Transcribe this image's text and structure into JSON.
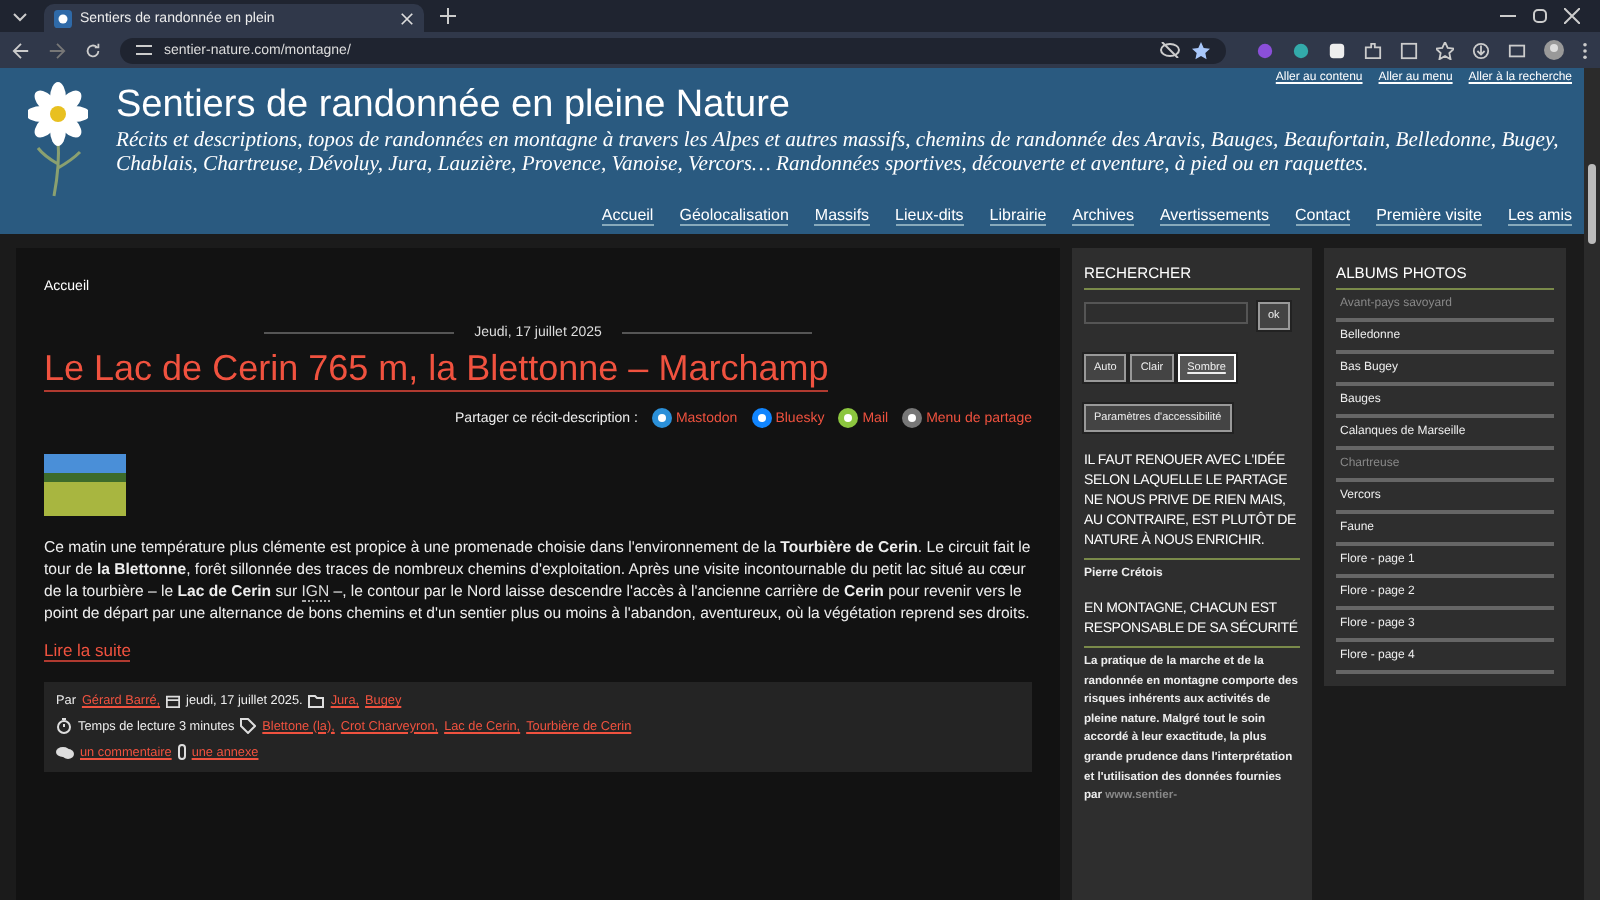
{
  "browser": {
    "tab_title": "Sentiers de randonnée en plein",
    "url": "sentier-nature.com/montagne/"
  },
  "skip_links": [
    "Aller au contenu",
    "Aller au menu",
    "Aller à la recherche"
  ],
  "header": {
    "title": "Sentiers de randonnée en pleine Nature",
    "tagline": "Récits et descriptions, topos de randonnées en montagne à travers les Alpes et autres massifs, chemins de randonnée des Aravis, Bauges, Beaufortain, Belledonne, Bugey, Chablais, Chartreuse, Dévoluy, Jura, Lauzière, Provence, Vanoise, Vercors… Randonnées sportives, découverte et aventure, à pied ou en raquettes."
  },
  "nav": [
    "Accueil",
    "Géolocalisation",
    "Massifs",
    "Lieux-dits",
    "Librairie",
    "Archives",
    "Avertissements",
    "Contact",
    "Première visite",
    "Les amis"
  ],
  "breadcrumb": "Accueil",
  "post": {
    "date": "Jeudi, 17 juillet 2025",
    "title": "Le Lac de Cerin 765 m, la Blettonne – Marchamp",
    "share_label": "Partager ce récit-description :",
    "share": [
      {
        "label": "Mastodon",
        "color": "#2b90d9"
      },
      {
        "label": "Bluesky",
        "color": "#1185fe"
      },
      {
        "label": "Mail",
        "color": "#8cc63f"
      },
      {
        "label": "Menu de partage",
        "color": "#777777"
      }
    ],
    "body_before": "Ce matin une température plus clémente est propice à une promenade choisie dans l'environnement de la **Tourbière de Cerin**. Le circuit fait le tour de **la Blettonne**, forêt sillonnée des traces de nombreux chemins d'exploitation. Après une visite incontournable du petit lac situé au cœur de la tourbière – le **Lac de Cerin** sur",
    "body_link": "IGN",
    "body_after": "–, le contour par le Nord laisse descendre l'accès à l'ancienne carrière de **Cerin** pour revenir vers le point de départ par une alternance de bons chemins et d'un sentier plus ou moins à l'abandon, aventureux, où la végétation reprend ses droits.",
    "read_more": "Lire la suite",
    "meta": {
      "by": "Par",
      "author": "Gérard Barré,",
      "date": "jeudi, 17 juillet 2025.",
      "categories": [
        "Jura,",
        "Bugey"
      ],
      "reading_time": "Temps de lecture 3 minutes",
      "tags": [
        "Blettone (la),",
        "Crot Charveyron,",
        "Lac de Cerin,",
        "Tourbière de Cerin"
      ],
      "comments": "un commentaire",
      "attachments": "une annexe"
    }
  },
  "search": {
    "title": "RECHERCHER",
    "button": "ok"
  },
  "themes": [
    {
      "label": "Auto",
      "selected": false
    },
    {
      "label": "Clair",
      "selected": false
    },
    {
      "label": "Sombre",
      "selected": true
    }
  ],
  "accessibility_button": "Paramètres d'accessibilité",
  "quote": {
    "text": "IL FAUT RENOUER AVEC L'IDÉE SELON LAQUELLE LE PARTAGE NE NOUS PRIVE DE RIEN MAIS, AU CONTRAIRE, EST PLUTÔT DE NATURE À NOUS ENRICHIR.",
    "author": "Pierre Crétois"
  },
  "safety": {
    "title": "EN MONTAGNE, CHACUN EST RESPONSABLE DE SA SÉCURITÉ",
    "text": "La pratique de la marche et de la randonnée en montagne comporte des risques inhérents aux activités de pleine nature. Malgré tout le soin accordé à leur exactitude, la plus grande prudence dans l'interprétation et l'utilisation des données fournies par",
    "link": "www.sentier-"
  },
  "albums": {
    "title": "ALBUMS PHOTOS",
    "items": [
      {
        "label": "Avant-pays savoyard",
        "disabled": true
      },
      {
        "label": "Belledonne",
        "disabled": false
      },
      {
        "label": "Bas Bugey",
        "disabled": false
      },
      {
        "label": "Bauges",
        "disabled": false
      },
      {
        "label": "Calanques de Marseille",
        "disabled": false
      },
      {
        "label": "Chartreuse",
        "disabled": true
      },
      {
        "label": "Vercors",
        "disabled": false
      },
      {
        "label": "Faune",
        "disabled": false
      },
      {
        "label": "Flore - page 1",
        "disabled": false
      },
      {
        "label": "Flore - page 2",
        "disabled": false
      },
      {
        "label": "Flore - page 3",
        "disabled": false
      },
      {
        "label": "Flore - page 4",
        "disabled": false
      }
    ]
  }
}
